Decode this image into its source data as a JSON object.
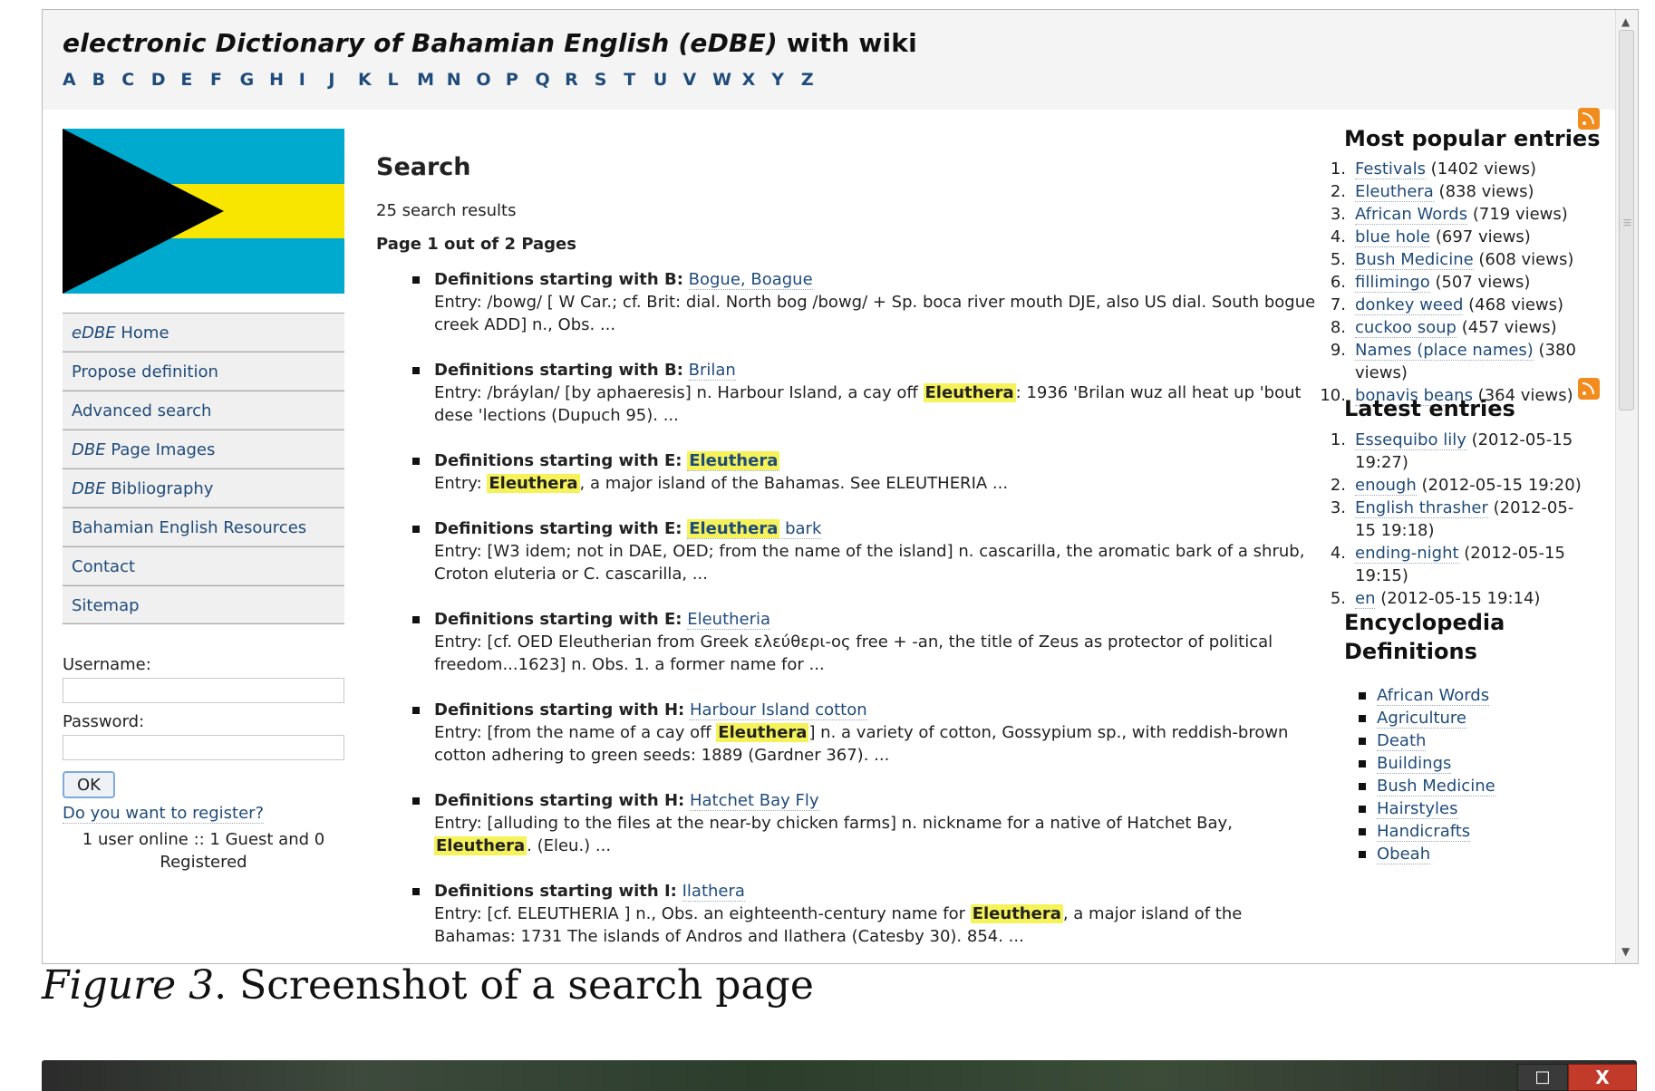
{
  "header": {
    "title_parts": [
      "electronic Dictionary of Bahamian English (eDBE)",
      " with wiki"
    ],
    "alphabet": [
      "A",
      "B",
      "C",
      "D",
      "E",
      "F",
      "G",
      "H",
      "I",
      "J",
      "K",
      "L",
      "M",
      "N",
      "O",
      "P",
      "Q",
      "R",
      "S",
      "T",
      "U",
      "V",
      "W",
      "X",
      "Y",
      "Z"
    ]
  },
  "flag": {
    "colors": {
      "blue": "#00a9ce",
      "yellow": "#f8e600",
      "black": "#000000"
    }
  },
  "menu": {
    "items": [
      {
        "em": "eDBE",
        "text": " Home"
      },
      {
        "em": "",
        "text": "Propose definition"
      },
      {
        "em": "",
        "text": "Advanced search"
      },
      {
        "em": "DBE",
        "text": " Page Images"
      },
      {
        "em": "DBE",
        "text": " Bibliography"
      },
      {
        "em": "",
        "text": "Bahamian English Resources"
      },
      {
        "em": "",
        "text": "Contact"
      },
      {
        "em": "",
        "text": "Sitemap"
      }
    ]
  },
  "login": {
    "username_label": "Username:",
    "password_label": "Password:",
    "username_value": "",
    "password_value": "",
    "ok_label": "OK",
    "register_link": "Do you want to register?",
    "users_online": "1 user online :: 1 Guest and 0 Registered"
  },
  "main": {
    "title": "Search",
    "result_count": "25 search results",
    "page_indicator": "Page 1 out of 2 Pages",
    "results": [
      {
        "prefix": "Definitions starting with B:",
        "title": [
          "Bogue, Boague"
        ],
        "entry": [
          "Entry: /bowg/ [ W Car.; cf. Brit: dial. North bog /bowg/ + Sp. boca river mouth DJE, also US dial. South bogue creek ADD] n., Obs. ..."
        ]
      },
      {
        "prefix": "Definitions starting with B:",
        "title": [
          "Brilan"
        ],
        "entry": [
          "Entry: /bráylan/ [by aphaeresis] n. Harbour Island, a cay off ",
          "Eleuthera",
          ": 1936 'Brilan wuz all heat up 'bout dese 'lections (Dupuch 95). ..."
        ]
      },
      {
        "prefix": "Definitions starting with E:",
        "title": [
          "",
          "Eleuthera"
        ],
        "entry": [
          "Entry: ",
          "Eleuthera",
          ", a major island of the Bahamas. See ELEUTHERIA ..."
        ]
      },
      {
        "prefix": "Definitions starting with E:",
        "title": [
          "",
          "Eleuthera",
          " bark"
        ],
        "entry": [
          "Entry: [W3 idem; not in DAE, OED; from the name of the island] n. cascarilla, the aromatic bark of a shrub, Croton eluteria or C. cascarilla, ..."
        ]
      },
      {
        "prefix": "Definitions starting with E:",
        "title": [
          "Eleutheria"
        ],
        "entry": [
          "Entry: [cf. OED Eleutherian from Greek ελεύθερι-ος free + -an, the title of Zeus as protector of political freedom...1623] n. Obs. 1. a former name for ..."
        ]
      },
      {
        "prefix": "Definitions starting with H:",
        "title": [
          "Harbour Island cotton"
        ],
        "entry": [
          "Entry: [from the name of a cay off ",
          "Eleuthera",
          "] n. a variety of cotton, Gossypium sp., with reddish-brown cotton adhering to green seeds: 1889 (Gardner 367). ..."
        ]
      },
      {
        "prefix": "Definitions starting with H:",
        "title": [
          "Hatchet Bay Fly"
        ],
        "entry": [
          "Entry: [alluding to the files at the near-by chicken farms] n. nickname for a native of Hatchet Bay, ",
          "Eleuthera",
          ". (Eleu.) ..."
        ]
      },
      {
        "prefix": "Definitions starting with I:",
        "title": [
          "Ilathera"
        ],
        "entry": [
          "Entry: [cf. ELEUTHERIA ] n., Obs. an eighteenth-century name for ",
          "Eleuthera",
          ", a major island of the Bahamas: 1731 The islands of Andros and Ilathera (Catesby 30). 854. ..."
        ]
      }
    ]
  },
  "sidebar": {
    "popular_title": "Most popular entries",
    "popular": [
      {
        "num": "1.",
        "link": "Festivals",
        "views": " (1402 views)"
      },
      {
        "num": "2.",
        "link": "Eleuthera",
        "views": " (838 views)"
      },
      {
        "num": "3.",
        "link": "African Words",
        "views": " (719 views)"
      },
      {
        "num": "4.",
        "link": "blue hole",
        "views": " (697 views)"
      },
      {
        "num": "5.",
        "link": "Bush Medicine",
        "views": " (608 views)"
      },
      {
        "num": "6.",
        "link": "fillimingo",
        "views": " (507 views)"
      },
      {
        "num": "7.",
        "link": "donkey weed",
        "views": " (468 views)"
      },
      {
        "num": "8.",
        "link": "cuckoo soup",
        "views": " (457 views)"
      },
      {
        "num": "9.",
        "link": "Names (place names)",
        "views": " (380 views)"
      },
      {
        "num": "10.",
        "link": "bonavis beans",
        "views": " (364 views)"
      }
    ],
    "latest_title": "Latest entries",
    "latest": [
      {
        "num": "1.",
        "link": "Essequibo lily",
        "views": " (2012-05-15 19:27)"
      },
      {
        "num": "2.",
        "link": "enough",
        "views": " (2012-05-15 19:20)"
      },
      {
        "num": "3.",
        "link": "English thrasher",
        "views": " (2012-05-15 19:18)"
      },
      {
        "num": "4.",
        "link": "ending-night",
        "views": " (2012-05-15 19:15)"
      },
      {
        "num": "5.",
        "link": "en",
        "views": " (2012-05-15 19:14)"
      }
    ],
    "encyclopedia_title": "Encyclopedia Definitions",
    "encyclopedia": [
      "African Words",
      "Agriculture",
      "Death",
      "Buildings",
      "Bush Medicine",
      "Hairstyles",
      "Handicrafts",
      "Obeah"
    ]
  },
  "caption": {
    "label": "Figure 3",
    "text": ". Screenshot of a search page"
  },
  "window_controls": {
    "maximize": "□",
    "close": "X"
  }
}
